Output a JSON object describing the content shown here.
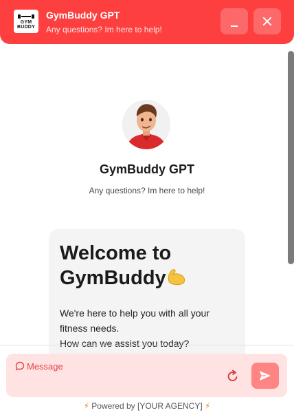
{
  "header": {
    "title": "GymBuddy GPT",
    "subtitle": "Any questions? Im here to help!",
    "logo_text_top": "GYM",
    "logo_text_bottom": "BUDDY"
  },
  "intro": {
    "bot_name": "GymBuddy GPT",
    "bot_subtitle": "Any questions? Im here to help!"
  },
  "welcome_card": {
    "title": "Welcome to GymBuddy",
    "title_icon": "flexed-bicep-icon",
    "line1": "We're here to help you with all your fitness needs.",
    "line2": "How can we assist you today?"
  },
  "composer": {
    "placeholder": "Message",
    "send_icon": "send-icon",
    "refresh_icon": "refresh-icon"
  },
  "footer": {
    "powered_text": "Powered by [YOUR AGENCY]"
  },
  "colors": {
    "brand": "#fd3f3f",
    "input_bg": "#ffe3e3",
    "send_bg": "#ff8585",
    "bolt": "#f08a24"
  }
}
